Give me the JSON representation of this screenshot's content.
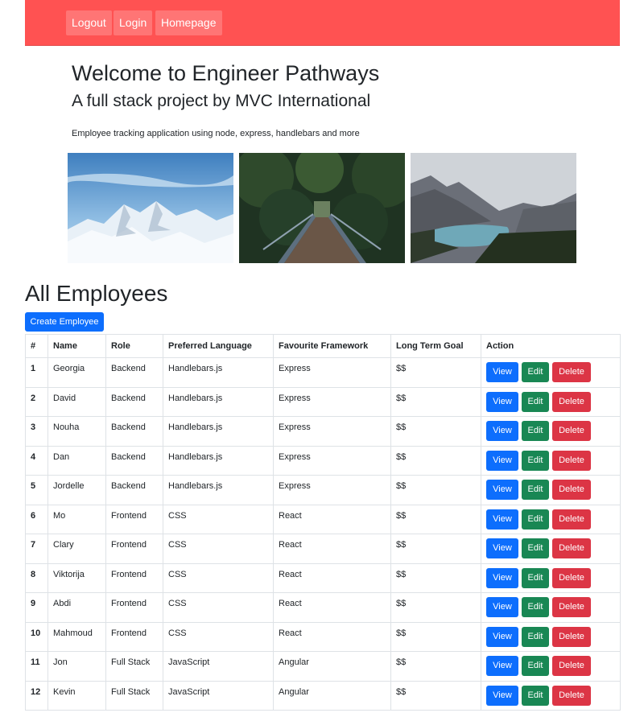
{
  "nav": {
    "logout": "Logout",
    "login": "Login",
    "homepage": "Homepage"
  },
  "colors": {
    "navbar": "#ff5252",
    "view": "#0d6efd",
    "edit": "#198754",
    "delete": "#dc3545"
  },
  "hero": {
    "title": "Welcome to Engineer Pathways",
    "subtitle": "A full stack project by MVC International",
    "description": "Employee tracking application using node, express, handlebars and more"
  },
  "section": {
    "title": "All Employees",
    "create_button": "Create Employee"
  },
  "table": {
    "headers": [
      "#",
      "Name",
      "Role",
      "Preferred Language",
      "Favourite Framework",
      "Long Term Goal",
      "Action"
    ],
    "actions": {
      "view": "View",
      "edit": "Edit",
      "delete": "Delete"
    },
    "rows": [
      {
        "id": "1",
        "name": "Georgia",
        "role": "Backend",
        "language": "Handlebars.js",
        "framework": "Express",
        "goal": "$$"
      },
      {
        "id": "2",
        "name": "David",
        "role": "Backend",
        "language": "Handlebars.js",
        "framework": "Express",
        "goal": "$$"
      },
      {
        "id": "3",
        "name": "Nouha",
        "role": "Backend",
        "language": "Handlebars.js",
        "framework": "Express",
        "goal": "$$"
      },
      {
        "id": "4",
        "name": "Dan",
        "role": "Backend",
        "language": "Handlebars.js",
        "framework": "Express",
        "goal": "$$"
      },
      {
        "id": "5",
        "name": "Jordelle",
        "role": "Backend",
        "language": "Handlebars.js",
        "framework": "Express",
        "goal": "$$"
      },
      {
        "id": "6",
        "name": "Mo",
        "role": "Frontend",
        "language": "CSS",
        "framework": "React",
        "goal": "$$"
      },
      {
        "id": "7",
        "name": "Clary",
        "role": "Frontend",
        "language": "CSS",
        "framework": "React",
        "goal": "$$"
      },
      {
        "id": "8",
        "name": "Viktorija",
        "role": "Frontend",
        "language": "CSS",
        "framework": "React",
        "goal": "$$"
      },
      {
        "id": "9",
        "name": "Abdi",
        "role": "Frontend",
        "language": "CSS",
        "framework": "React",
        "goal": "$$"
      },
      {
        "id": "10",
        "name": "Mahmoud",
        "role": "Frontend",
        "language": "CSS",
        "framework": "React",
        "goal": "$$"
      },
      {
        "id": "11",
        "name": "Jon",
        "role": "Full Stack",
        "language": "JavaScript",
        "framework": "Angular",
        "goal": "$$"
      },
      {
        "id": "12",
        "name": "Kevin",
        "role": "Full Stack",
        "language": "JavaScript",
        "framework": "Angular",
        "goal": "$$"
      }
    ]
  }
}
